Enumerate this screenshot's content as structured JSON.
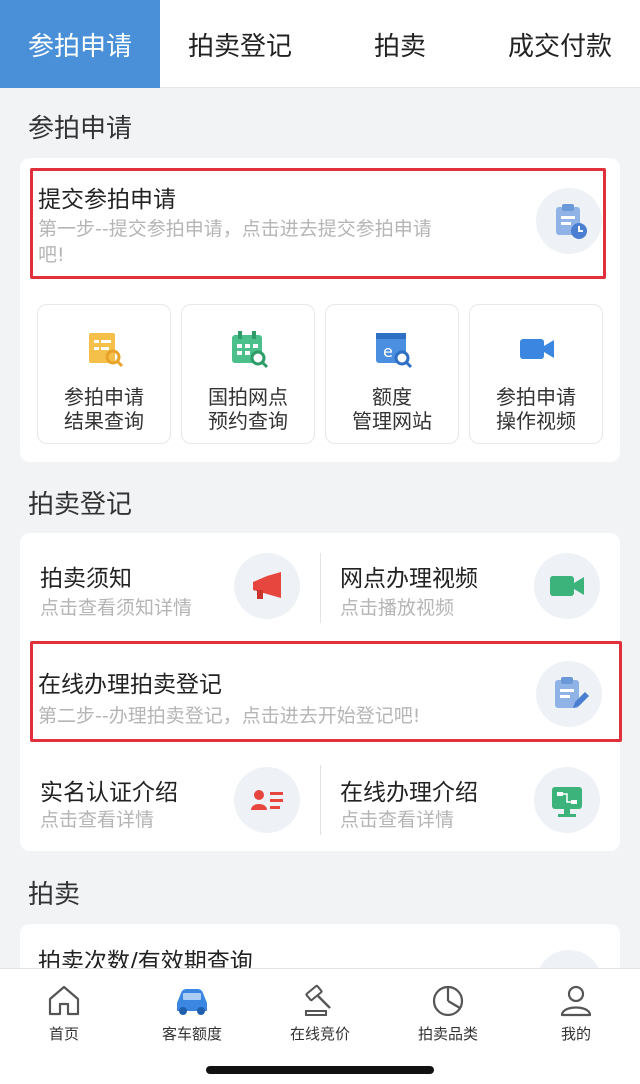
{
  "tabs": [
    {
      "label": "参拍申请"
    },
    {
      "label": "拍卖登记"
    },
    {
      "label": "拍卖"
    },
    {
      "label": "成交付款"
    }
  ],
  "section1": {
    "title": "参拍申请",
    "submit": {
      "title": "提交参拍申请",
      "desc_line1": "第一步--提交参拍申请，点击进去提交参拍申请",
      "desc_line2": "吧!",
      "icon": "clipboard-clock-icon"
    },
    "grid": [
      {
        "line1": "参拍申请",
        "line2": "结果查询",
        "icon": "document-search-icon"
      },
      {
        "line1": "国拍网点",
        "line2": "预约查询",
        "icon": "calendar-search-icon"
      },
      {
        "line1": "额度",
        "line2": "管理网站",
        "icon": "browser-search-icon"
      },
      {
        "line1": "参拍申请",
        "line2": "操作视频",
        "icon": "video-camera-icon"
      }
    ]
  },
  "section2": {
    "title": "拍卖登记",
    "notice": {
      "title": "拍卖须知",
      "sub": "点击查看须知详情",
      "icon": "megaphone-icon"
    },
    "branch_video": {
      "title": "网点办理视频",
      "sub": "点击播放视频",
      "icon": "video-icon"
    },
    "online_register": {
      "title": "在线办理拍卖登记",
      "sub": "第二步--办理拍卖登记，点击进去开始登记吧!",
      "icon": "clipboard-edit-icon"
    },
    "realname": {
      "title": "实名认证介绍",
      "sub": "点击查看详情",
      "icon": "id-card-icon"
    },
    "online_intro": {
      "title": "在线办理介绍",
      "sub": "点击查看详情",
      "icon": "monitor-icon"
    }
  },
  "section3": {
    "title": "拍卖",
    "query": {
      "title": "拍卖次数/有效期查询"
    }
  },
  "bottom_nav": [
    {
      "label": "首页",
      "icon": "home-icon"
    },
    {
      "label": "客车额度",
      "icon": "car-icon"
    },
    {
      "label": "在线竞价",
      "icon": "gavel-icon"
    },
    {
      "label": "拍卖品类",
      "icon": "pie-icon"
    },
    {
      "label": "我的",
      "icon": "user-icon"
    }
  ],
  "colors": {
    "accent": "#4a90d9",
    "highlight": "#e0303b",
    "green": "#3cb37a",
    "red": "#e7463f",
    "orange": "#f5a623"
  }
}
